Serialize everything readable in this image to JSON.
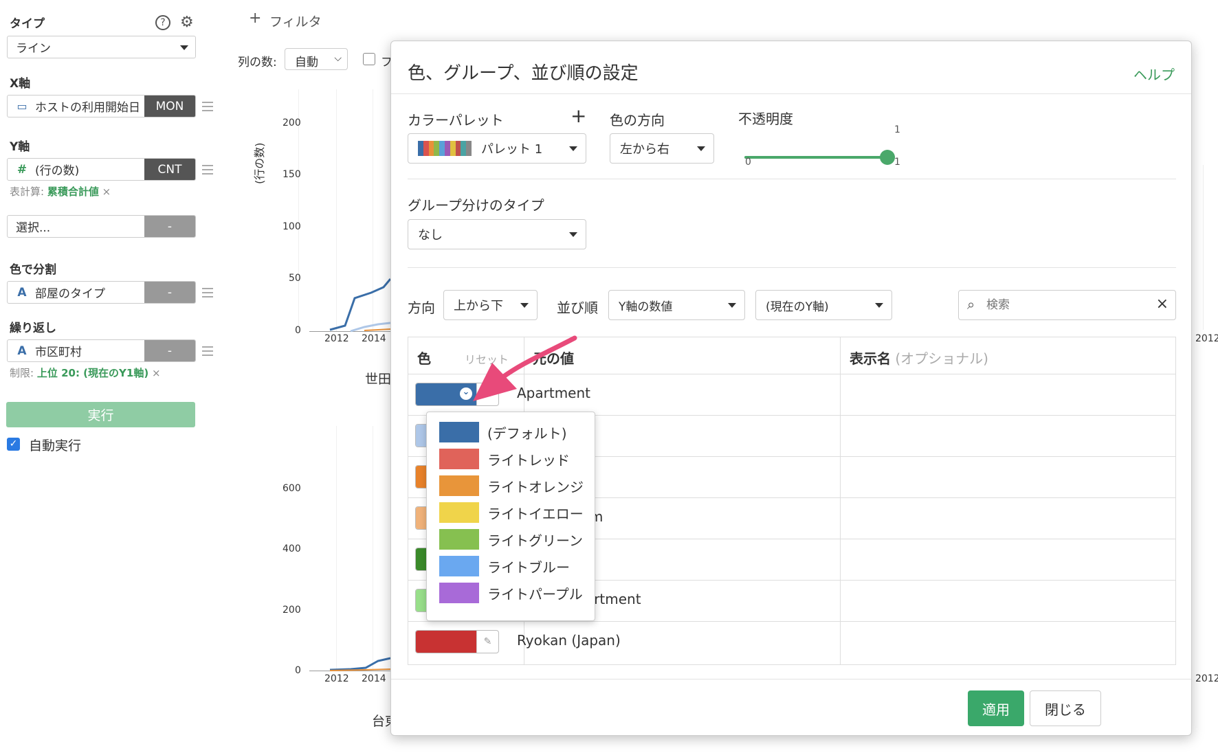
{
  "sidebar": {
    "type_label": "タイプ",
    "type_value": "ライン",
    "x_label": "X軸",
    "x_field": "ホストの利用開始日",
    "x_badge": "MON",
    "y_label": "Y軸",
    "y_field": "(行の数)",
    "y_badge": "CNT",
    "calc_prefix": "表計算:",
    "calc_value": "累積合計値",
    "select_placeholder": "選択...",
    "select_badge": "-",
    "color_label": "色で分割",
    "color_field": "部屋のタイプ",
    "color_badge": "-",
    "repeat_label": "繰り返し",
    "repeat_field": "市区町村",
    "repeat_badge": "-",
    "limit_prefix": "制限:",
    "limit_value": "上位 20: (現在のY1軸)",
    "run_label": "実行",
    "auto_run_label": "自動実行",
    "auto_run_checked": true
  },
  "chart_toolbar": {
    "filter_label": "フィルタ",
    "columns_label": "列の数:",
    "columns_value": "自動",
    "check_label": "フ"
  },
  "chart_area": {
    "ylabel": "(行の数)",
    "top_yticks": [
      "200",
      "150",
      "100",
      "50",
      "0"
    ],
    "top_xticks": [
      "2012",
      "2014"
    ],
    "top_title": "世田",
    "bottom_yticks": [
      "600",
      "400",
      "200",
      "0"
    ],
    "bottom_xticks": [
      "2012",
      "2014"
    ],
    "bottom_title": "台東",
    "right_xtick_top": "2012",
    "right_xtick_bottom": "2012"
  },
  "modal": {
    "title": "色、グループ、並び順の設定",
    "help": "ヘルプ",
    "palette_label": "カラーパレット",
    "palette_add": "+",
    "palette_value": "パレット 1",
    "palette_colors": [
      "#3a6ea8",
      "#d9534f",
      "#e8913a",
      "#8fb84a",
      "#5aa0d8",
      "#9b59b6",
      "#e0c040",
      "#c0504d",
      "#4aa3a3",
      "#888888"
    ],
    "direction_label": "色の方向",
    "direction_value": "左から右",
    "opacity_label": "不透明度",
    "opacity_value": 1,
    "opacity_value_text": "1",
    "opacity_min": "0",
    "opacity_max": "1",
    "group_type_label": "グループ分けのタイプ",
    "group_type_value": "なし",
    "order_dir_label": "方向",
    "order_dir_value": "上から下",
    "sort_label": "並び順",
    "sort_value": "Y軸の数値",
    "sort_axis_value": "(現在のY軸)",
    "search_placeholder": "検索",
    "table": {
      "col_color": "色",
      "reset": "リセット",
      "col_value": "元の値",
      "col_display": "表示名",
      "col_display_note": "(オプショナル)",
      "rows": [
        {
          "value": "Apartment",
          "color": "#3a6ea8"
        },
        {
          "value": "",
          "color": "#aec7e8"
        },
        {
          "value": "",
          "color": "#e8822a"
        },
        {
          "value": "nium",
          "color": "#f0b27a"
        },
        {
          "value": "",
          "color": "#3a8a2a"
        },
        {
          "value": "apartment",
          "color": "#98df8a"
        },
        {
          "value": "Ryokan (Japan)",
          "color": "#c83232"
        }
      ]
    },
    "apply": "適用",
    "close": "閉じる"
  },
  "color_dropdown": {
    "items": [
      {
        "name": "(デフォルト)",
        "color": "#3a6ea8"
      },
      {
        "name": "ライトレッド",
        "color": "#e0635a"
      },
      {
        "name": "ライトオレンジ",
        "color": "#e8953a"
      },
      {
        "name": "ライトイエロー",
        "color": "#f0d44a"
      },
      {
        "name": "ライトグリーン",
        "color": "#86c050"
      },
      {
        "name": "ライトブルー",
        "color": "#6aa8f0"
      },
      {
        "name": "ライトパープル",
        "color": "#a86ad8"
      }
    ]
  }
}
